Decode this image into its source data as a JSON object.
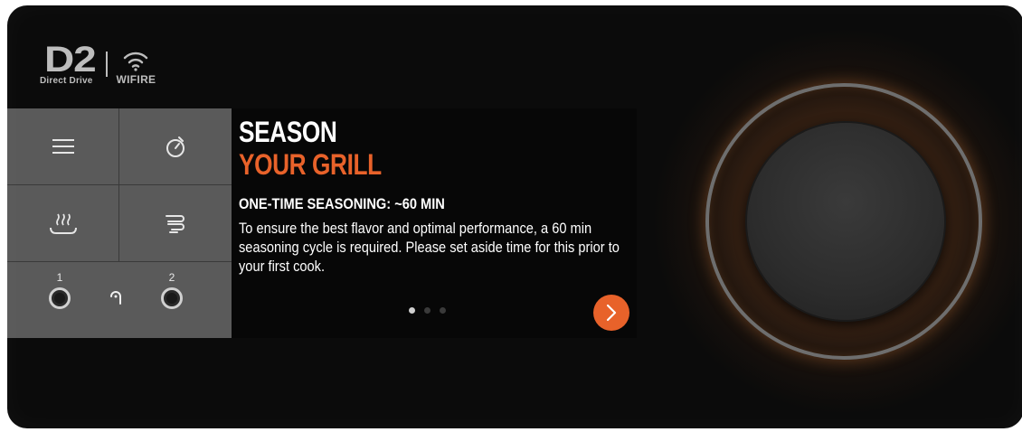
{
  "brand": {
    "logo_main": "D2",
    "logo_sub": "Direct Drive",
    "wifi_label": "WIFIRE"
  },
  "controls": {
    "menu_icon": "menu-icon",
    "timer_icon": "timer-icon",
    "keep_warm_icon": "keep-warm-icon",
    "smoke_icon": "smoke-icon",
    "probes": [
      {
        "label": "1"
      },
      {
        "label": "2"
      }
    ],
    "probe_link_icon": "probe-icon"
  },
  "panel": {
    "title_line1": "SEASON",
    "title_line2": "YOUR GRILL",
    "subtitle": "ONE-TIME SEASONING: ~60 MIN",
    "body": "To ensure the best flavor and optimal performance, a 60 min seasoning cycle is required. Please set aside time for this prior to your first cook.",
    "page_count": 3,
    "active_page": 1
  },
  "colors": {
    "accent": "#e8622a",
    "panel_bg": "#5a5a5a",
    "device_bg": "#0b0b0b"
  }
}
